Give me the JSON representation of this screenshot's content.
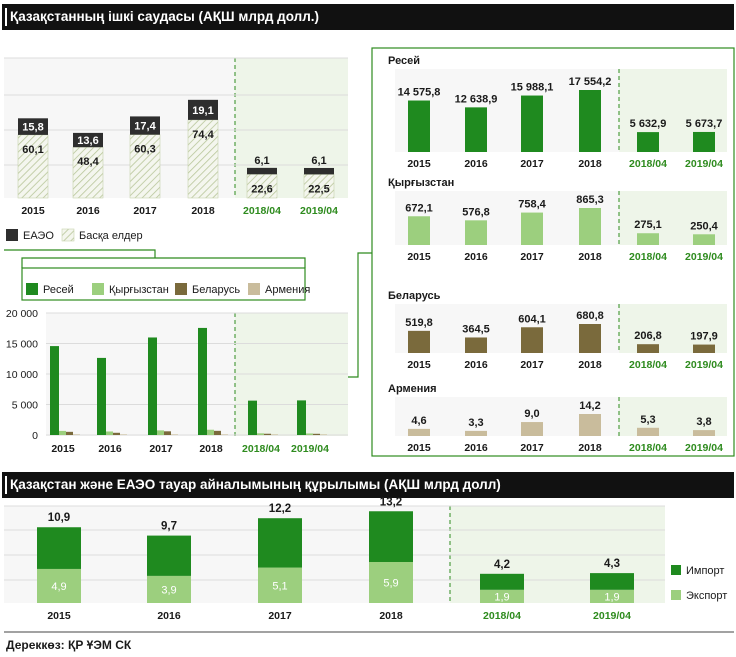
{
  "title_top": "Қазақстанның ішкі саудасы (АҚШ млрд долл.)",
  "title_bottom": "Қазақстан және ЕАЭО тауар айналымының құрылымы (АҚШ млрд долл)",
  "source": "Дереккөз: ҚР ҰЭМ СК",
  "colors": {
    "dark": "#2e2e2e",
    "green": "#1f8a1f",
    "light_green": "#9ccf7e",
    "olive": "#7a6a3c",
    "beige": "#c9bc9c",
    "forecast_bg": "#eef5e9",
    "period_green": "#2e8b1e"
  },
  "legend_top": {
    "eaeo": "ЕАЭО",
    "other": "Басқа елдер"
  },
  "legend_countries": [
    "Ресей",
    "Қырғызстан",
    "Беларусь",
    "Армения"
  ],
  "legend_bottom": {
    "import": "Импорт",
    "export": "Экспорт"
  },
  "chart_data": [
    {
      "type": "bar",
      "title": "Қазақстанның ішкі саудасы (АҚШ млрд долл.)",
      "categories": [
        "2015",
        "2016",
        "2017",
        "2018",
        "2018/04",
        "2019/04"
      ],
      "series": [
        {
          "name": "ЕАЭО",
          "values": [
            15.8,
            13.6,
            17.4,
            19.1,
            6.1,
            6.1
          ],
          "labels": [
            "15,8",
            "13,6",
            "17,4",
            "19,1",
            "6,1",
            "6,1"
          ]
        },
        {
          "name": "Басқа елдер",
          "values": [
            60.1,
            48.4,
            60.3,
            74.4,
            22.6,
            22.5
          ],
          "labels": [
            "60,1",
            "48,4",
            "60,3",
            "74,4",
            "22,6",
            "22,5"
          ]
        }
      ]
    },
    {
      "type": "bar",
      "categories": [
        "2015",
        "2016",
        "2017",
        "2018",
        "2018/04",
        "2019/04"
      ],
      "yticks": [
        "0",
        "5 000",
        "10 000",
        "15 000",
        "20 000"
      ],
      "ylim": [
        0,
        20000
      ],
      "series": [
        {
          "name": "Ресей",
          "values": [
            14575.8,
            12638.9,
            15988.1,
            17554.2,
            5632.9,
            5673.7
          ]
        },
        {
          "name": "Қырғызстан",
          "values": [
            672.1,
            576.8,
            758.4,
            865.3,
            275.1,
            250.4
          ]
        },
        {
          "name": "Беларусь",
          "values": [
            519.8,
            364.5,
            604.1,
            680.8,
            206.8,
            197.9
          ]
        },
        {
          "name": "Армения",
          "values": [
            4.6,
            3.3,
            9.0,
            14.2,
            5.3,
            3.8
          ]
        }
      ]
    },
    {
      "type": "bar",
      "title": "Ресей",
      "categories": [
        "2015",
        "2016",
        "2017",
        "2018",
        "2018/04",
        "2019/04"
      ],
      "values": [
        14575.8,
        12638.9,
        15988.1,
        17554.2,
        5632.9,
        5673.7
      ],
      "labels": [
        "14 575,8",
        "12 638,9",
        "15 988,1",
        "17 554,2",
        "5 632,9",
        "5 673,7"
      ]
    },
    {
      "type": "bar",
      "title": "Қырғызстан",
      "categories": [
        "2015",
        "2016",
        "2017",
        "2018",
        "2018/04",
        "2019/04"
      ],
      "values": [
        672.1,
        576.8,
        758.4,
        865.3,
        275.1,
        250.4
      ],
      "labels": [
        "672,1",
        "576,8",
        "758,4",
        "865,3",
        "275,1",
        "250,4"
      ]
    },
    {
      "type": "bar",
      "title": "Беларусь",
      "categories": [
        "2015",
        "2016",
        "2017",
        "2018",
        "2018/04",
        "2019/04"
      ],
      "values": [
        519.8,
        364.5,
        604.1,
        680.8,
        206.8,
        197.9
      ],
      "labels": [
        "519,8",
        "364,5",
        "604,1",
        "680,8",
        "206,8",
        "197,9"
      ]
    },
    {
      "type": "bar",
      "title": "Армения",
      "categories": [
        "2015",
        "2016",
        "2017",
        "2018",
        "2018/04",
        "2019/04"
      ],
      "values": [
        4.6,
        3.3,
        9.0,
        14.2,
        5.3,
        3.8
      ],
      "labels": [
        "4,6",
        "3,3",
        "9,0",
        "14,2",
        "5,3",
        "3,8"
      ]
    },
    {
      "type": "bar",
      "title": "Қазақстан және ЕАЭО тауар айналымының құрылымы (АҚШ млрд долл)",
      "categories": [
        "2015",
        "2016",
        "2017",
        "2018",
        "2018/04",
        "2019/04"
      ],
      "totals": [
        "10,9",
        "9,7",
        "12,2",
        "13,2",
        "4,2",
        "4,3"
      ],
      "series": [
        {
          "name": "Импорт",
          "values": [
            6.0,
            5.8,
            7.1,
            7.3,
            2.3,
            2.4
          ]
        },
        {
          "name": "Экспорт",
          "values": [
            4.9,
            3.9,
            5.1,
            5.9,
            1.9,
            1.9
          ],
          "labels": [
            "4,9",
            "3,9",
            "5,1",
            "5,9",
            "1,9",
            "1,9"
          ]
        }
      ]
    }
  ]
}
